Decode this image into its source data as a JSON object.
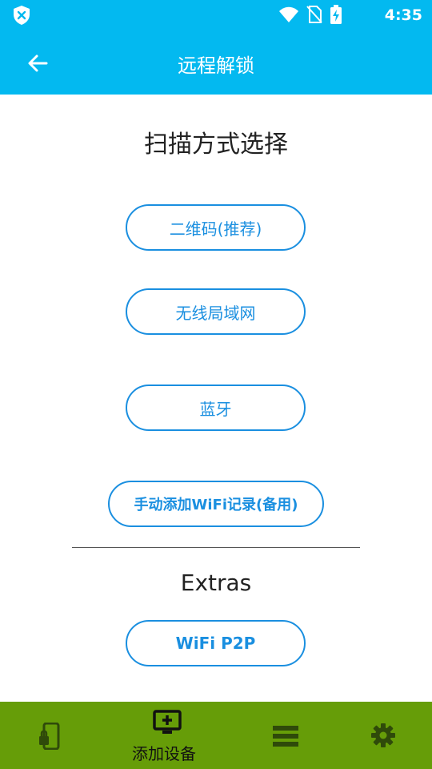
{
  "status_bar": {
    "time": "4:35",
    "icons": [
      "shield-x-icon",
      "wifi-icon",
      "no-sim-icon",
      "battery-charging-icon"
    ]
  },
  "app_bar": {
    "title": "远程解锁",
    "back_icon": "arrow-left-icon"
  },
  "scan_section": {
    "title": "扫描方式选择",
    "buttons": [
      {
        "label": "二维码(推荐)"
      },
      {
        "label": "无线局域网"
      },
      {
        "label": "蓝牙"
      },
      {
        "label": "手动添加WiFi记录(备用)"
      }
    ]
  },
  "extras_section": {
    "title": "Extras",
    "buttons": [
      {
        "label": "WiFi P2P"
      }
    ]
  },
  "bottom_nav": {
    "items": [
      {
        "icon": "phone-lock-icon",
        "label": ""
      },
      {
        "icon": "add-device-icon",
        "label": "添加设备",
        "selected": true
      },
      {
        "icon": "list-icon",
        "label": ""
      },
      {
        "icon": "settings-icon",
        "label": ""
      }
    ]
  },
  "colors": {
    "primary": "#03b9f0",
    "accent": "#1a8fe0",
    "nav_background": "#669d08"
  }
}
